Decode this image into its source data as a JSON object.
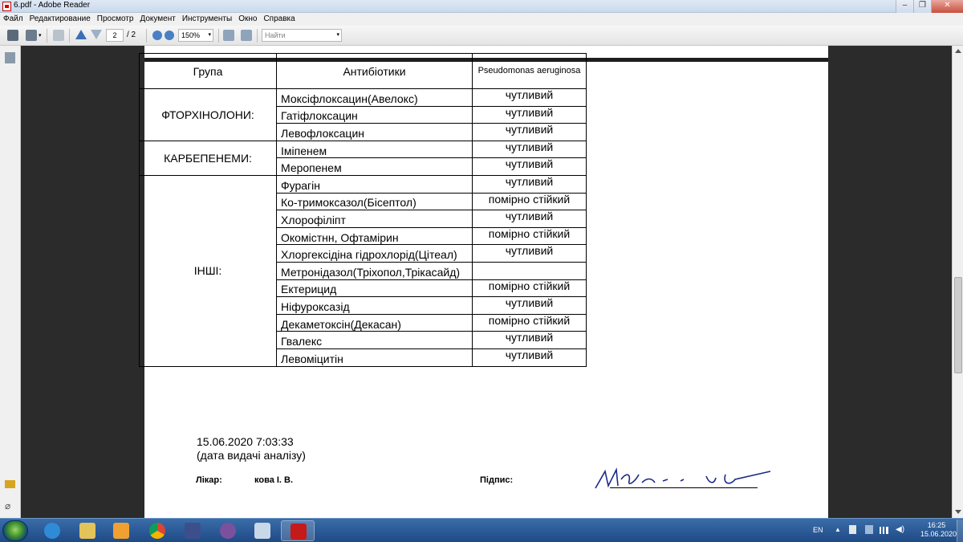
{
  "window": {
    "title": "6.pdf - Adobe Reader"
  },
  "menu": [
    "Файл",
    "Редактирование",
    "Просмотр",
    "Документ",
    "Инструменты",
    "Окно",
    "Справка"
  ],
  "toolbar": {
    "page_current": "2",
    "page_total": "/ 2",
    "zoom": "150%",
    "search_placeholder": "Найти"
  },
  "table": {
    "headers": {
      "group": "Група",
      "antibiotics": "Антибіотики",
      "organism": "Pseudomonas aeruginosa"
    },
    "groups": [
      {
        "name": "ФТОРХІНОЛОНИ:",
        "rows": [
          {
            "drug": "Моксіфлоксацин(Авелокс)",
            "result": "чутливий"
          },
          {
            "drug": "Гатіфлоксацин",
            "result": "чутливий"
          },
          {
            "drug": "Левофлоксацин",
            "result": "чутливий"
          }
        ]
      },
      {
        "name": "КАРБЕПЕНЕМИ:",
        "rows": [
          {
            "drug": "Іміпенем",
            "result": "чутливий"
          },
          {
            "drug": "Меропенем",
            "result": "чутливий"
          }
        ]
      },
      {
        "name": "ІНШІ:",
        "rows": [
          {
            "drug": "Фурагін",
            "result": "чутливий"
          },
          {
            "drug": "Ко-тримоксазол(Бісептол)",
            "result": "помірно стійкий"
          },
          {
            "drug": "Хлорофіліпт",
            "result": "чутливий"
          },
          {
            "drug": "Окомістнн, Офтамірин",
            "result": "помірно стійкий"
          },
          {
            "drug": "Хлоргексідіна гідрохлорід(Цітеал)",
            "result": "чутливий"
          },
          {
            "drug": "Метронідазол(Тріхопол,Трікасайд)",
            "result": ""
          },
          {
            "drug": "Ектерицид",
            "result": "помірно стійкий"
          },
          {
            "drug": "Ніфуроксазід",
            "result": "чутливий"
          },
          {
            "drug": "Декаметоксін(Декасан)",
            "result": "помірно стійкий"
          },
          {
            "drug": "Гвалекс",
            "result": "чутливий"
          },
          {
            "drug": "Левоміцитін",
            "result": "чутливий"
          }
        ]
      }
    ]
  },
  "footer": {
    "issue_datetime": "15.06.2020 7:03:33",
    "issue_caption": "(дата видачі аналізу)",
    "doctor_label": "Лікар:",
    "doctor_name": "кова І. В.",
    "signature_label": "Підпис:"
  },
  "tray": {
    "language": "EN",
    "time": "16:25",
    "date": "15.06.2020"
  }
}
